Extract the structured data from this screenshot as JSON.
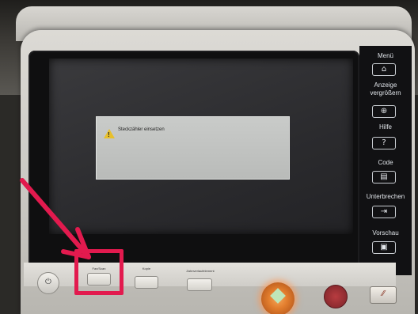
{
  "dialog": {
    "message": "Steckzähler einsetzen"
  },
  "side_panel": {
    "menu_label": "Menü",
    "zoom_label_line1": "Anzeige",
    "zoom_label_line2": "vergrößern",
    "help_label": "Hilfe",
    "help_glyph": "?",
    "code_label": "Code",
    "interrupt_label": "Unterbrechen",
    "preview_label": "Vorschau"
  },
  "hardware_keys": {
    "fax_scan_label": "Fax/Scan",
    "copy_label": "Kopie",
    "user_box_label": "Zahnverlaufelement"
  },
  "colors": {
    "annotation": "#e21a4e",
    "warning": "#e8c02a",
    "start_glow": "#f3a65a",
    "stop": "#b83c40"
  },
  "icons": {
    "menu": "home-icon",
    "zoom": "magnifier-plus-icon",
    "help": "question-icon",
    "code": "code-icon",
    "interrupt": "interrupt-icon",
    "preview": "preview-icon",
    "power": "power-icon",
    "start": "start-diamond-icon",
    "reset": "reset-icon",
    "warning": "warning-icon"
  }
}
